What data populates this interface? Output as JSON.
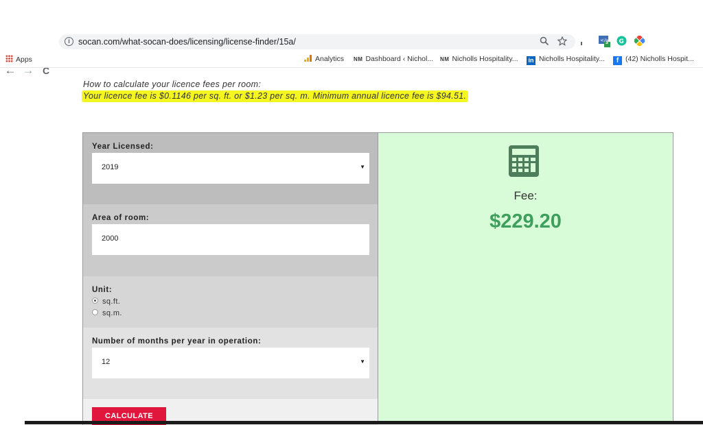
{
  "browser": {
    "url": "socan.com/what-socan-does/licensing/license-finder/15a/",
    "nav_back": "←",
    "nav_forward": "→",
    "nav_reload": "C",
    "zoom_icon": "magnifier-icon",
    "star_icon": "star-icon",
    "ext_badge": "3"
  },
  "bookmarks": {
    "apps": "Apps",
    "items": [
      {
        "prefix": "",
        "label": "Analytics"
      },
      {
        "prefix": "NM",
        "label": "Dashboard ‹ Nichol..."
      },
      {
        "prefix": "NM",
        "label": "Nicholls Hospitality..."
      },
      {
        "prefix": "in",
        "label": "Nicholls Hospitality..."
      },
      {
        "prefix": "f",
        "label": "(42) Nicholls Hospit..."
      }
    ]
  },
  "page": {
    "intro": "How to calculate your licence fees per room:",
    "highlight": "Your licence fee is $0.1146 per sq. ft. or $1.23 per sq. m. Minimum annual licence fee is $94.51."
  },
  "form": {
    "year_label": "Year Licensed:",
    "year_value": "2019",
    "area_label": "Area of room:",
    "area_value": "2000",
    "unit_label": "Unit:",
    "unit_options": [
      "sq.ft.",
      "sq.m."
    ],
    "unit_selected": "sq.ft.",
    "months_label": "Number of months per year in operation:",
    "months_value": "12",
    "calculate_label": "CALCULATE"
  },
  "result": {
    "fee_label": "Fee:",
    "fee_value": "$229.20"
  },
  "colors": {
    "highlight": "#f5f520",
    "button": "#e0163c",
    "result_bg": "#d8fcd8",
    "fee_green": "#3e9e5c",
    "icon_green": "#4e7d5b"
  }
}
